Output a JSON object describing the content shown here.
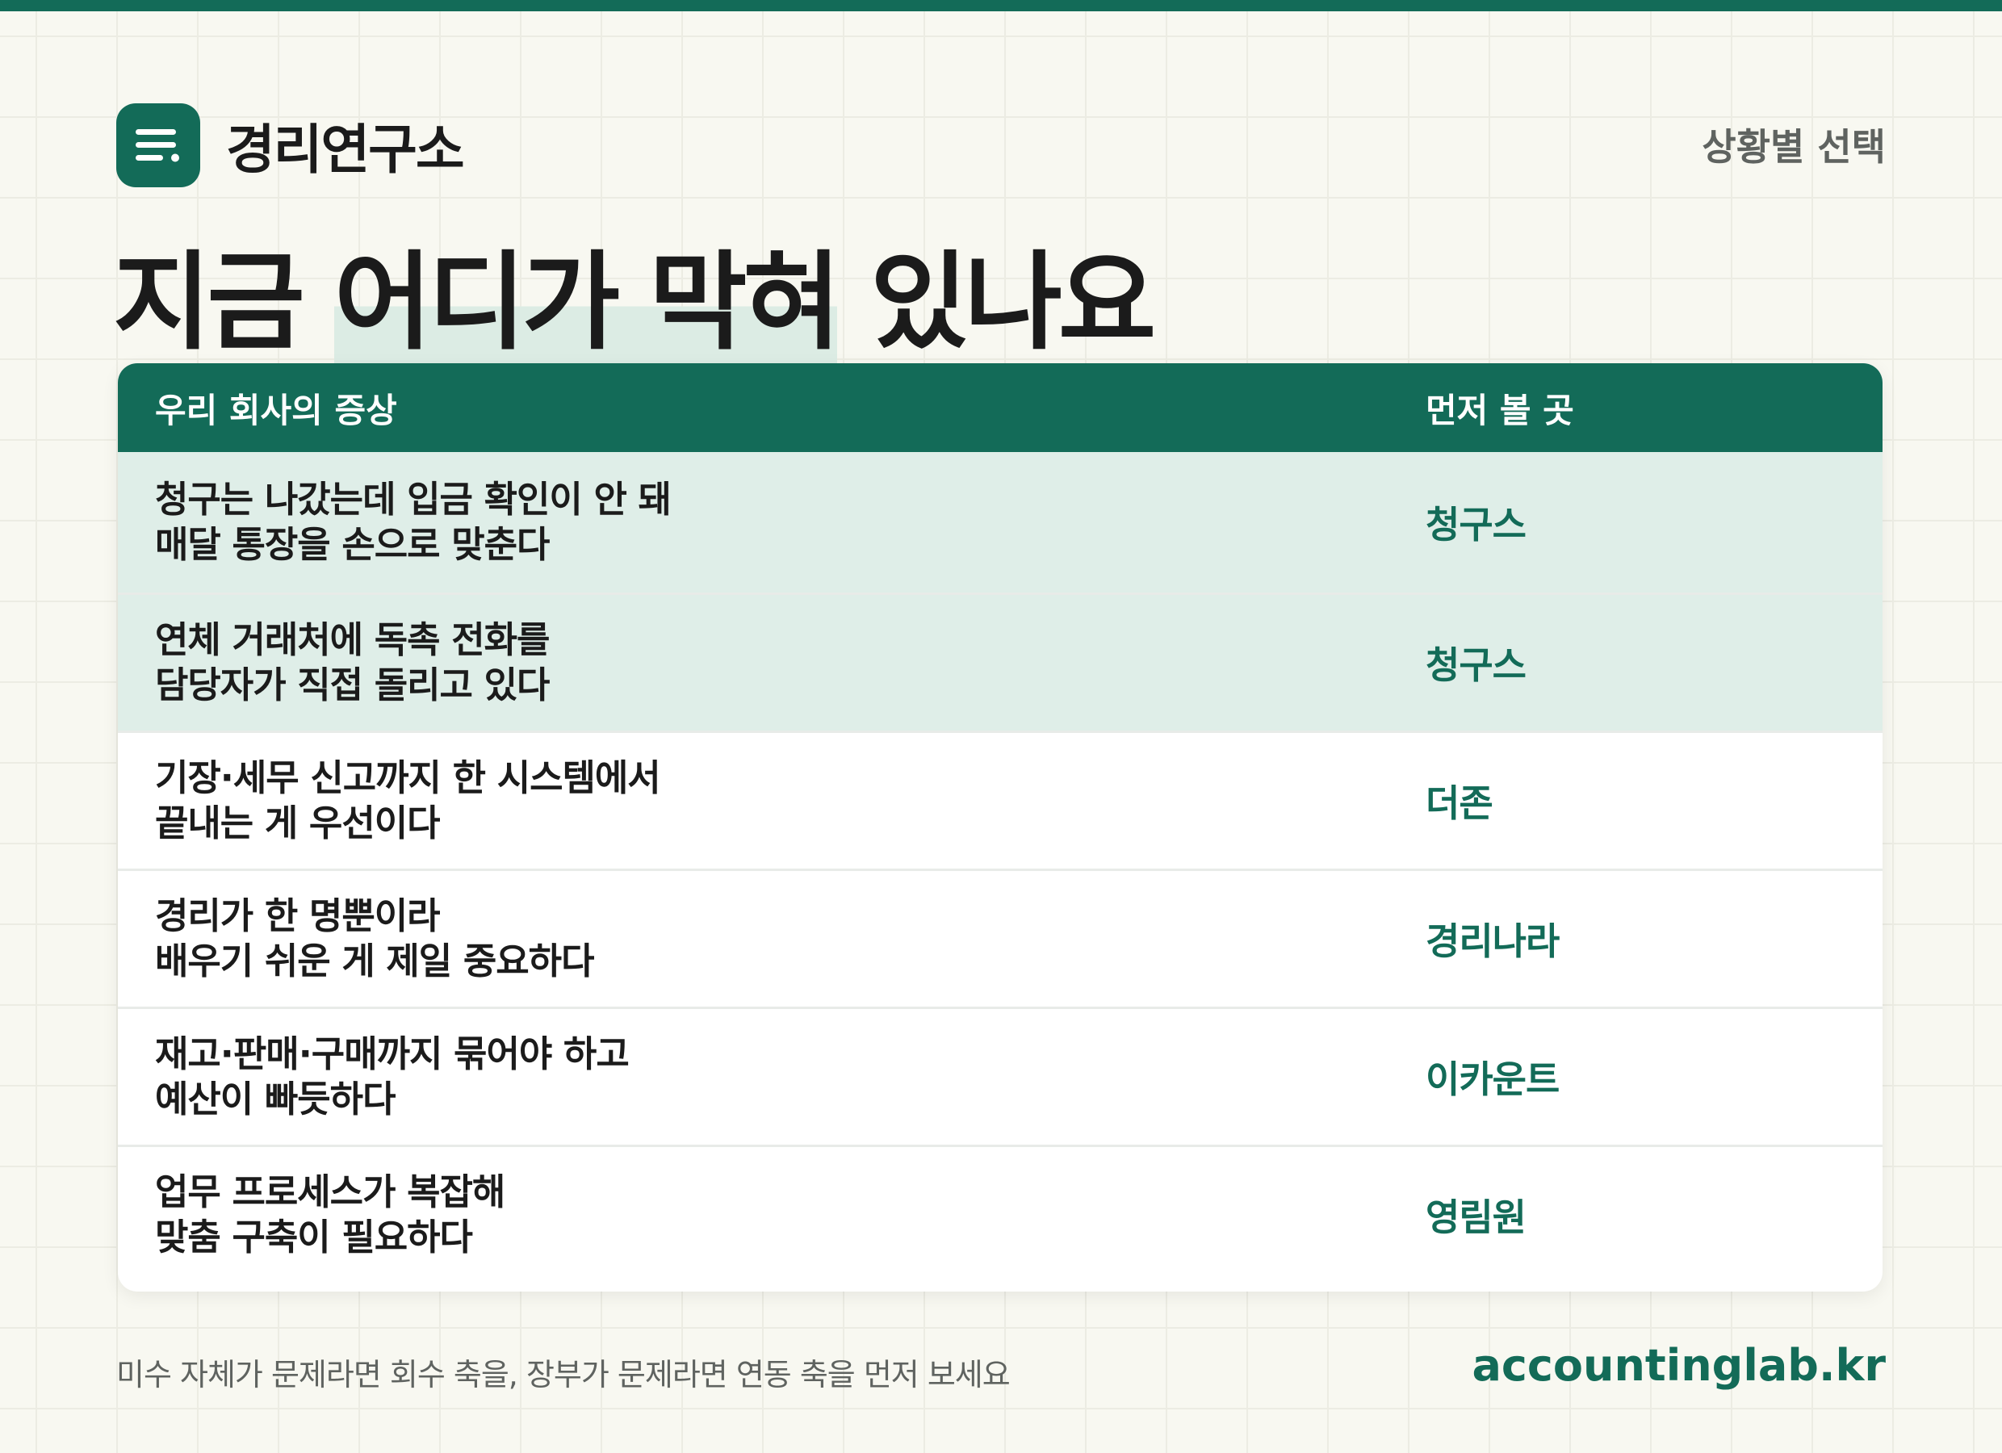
{
  "brand": {
    "name": "경리연구소",
    "logo_icon": "document-lines-icon"
  },
  "header": {
    "nav_label": "상황별 선택"
  },
  "headline": {
    "part1": "지금 ",
    "part2": "어디가 막혀",
    "part3": " 있나요"
  },
  "table": {
    "columns": [
      "우리 회사의 증상",
      "먼저 볼 곳"
    ],
    "rows": [
      {
        "symptom_line1": "청구는 나갔는데 입금 확인이 안 돼",
        "symptom_line2": "매달 통장을 손으로 맞춘다",
        "destination": "청구스",
        "highlighted": true
      },
      {
        "symptom_line1": "연체 거래처에 독촉 전화를",
        "symptom_line2": "담당자가 직접 돌리고 있다",
        "destination": "청구스",
        "highlighted": true
      },
      {
        "symptom_line1": "기장·세무 신고까지 한 시스템에서",
        "symptom_line2": "끝내는 게 우선이다",
        "destination": "더존",
        "highlighted": false
      },
      {
        "symptom_line1": "경리가 한 명뿐이라",
        "symptom_line2": "배우기 쉬운 게 제일 중요하다",
        "destination": "경리나라",
        "highlighted": false
      },
      {
        "symptom_line1": "재고·판매·구매까지 묶어야 하고",
        "symptom_line2": "예산이 빠듯하다",
        "destination": "이카운트",
        "highlighted": false
      },
      {
        "symptom_line1": "업무 프로세스가 복잡해",
        "symptom_line2": "맞춤 구축이 필요하다",
        "destination": "영림원",
        "highlighted": false
      }
    ]
  },
  "footer": {
    "note": "미수 자체가 문제라면 회수 축을, 장부가 문제라면 연동 축을 먼저 보세요",
    "site": "accountinglab.kr"
  },
  "colors": {
    "brand": "#136b58",
    "highlight_row": "#dfeee8",
    "background": "#f8f8f1"
  }
}
